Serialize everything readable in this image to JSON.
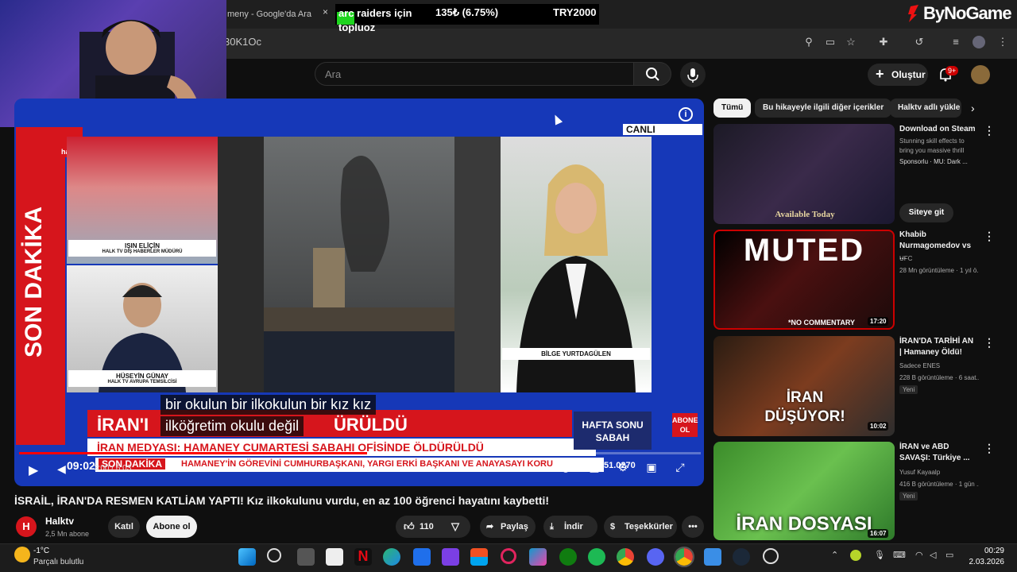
{
  "browser": {
    "tab_title": "meny - Google'da Ara",
    "tab_close": "×",
    "url": "30K1Oc"
  },
  "overlay": {
    "ticker_name": "arc raiders için topluoz",
    "ticker_price": "135₺ (6.75%)",
    "ticker_currency": "TRY2000",
    "brand": "ByNoGame"
  },
  "youtube_header": {
    "search_placeholder": "Ara",
    "create_label": "Oluştur",
    "notification_count": "9+"
  },
  "player": {
    "live_badge": "CANLI",
    "side_banner": "SON DAKİKA",
    "logo_text": "halk",
    "panel_name_1": "IŞIN ELİÇİN",
    "panel_role_1": "HALK TV DIŞ HABERLER MÜDÜRÜ",
    "panel_name_2": "HÜSEYİN GÜNAY",
    "panel_role_2": "HALK TV AVRUPA TEMSİLCİSİ",
    "panel_name_3": "BİLGE YURTDAGÜLEN",
    "headline": "İRAN'I",
    "headline_end": "ÜRÜLDÜ",
    "subline": "İRAN MEDYASI: HAMANEY CUMARTESİ SABAHI OFİSİNDE ÖLDÜRÜLDÜ",
    "program": "HAFTA SONU SABAH",
    "abone": "ABONE OL",
    "ticker_label": "SON DAKİKA",
    "ticker_text": "HAMANEY'İN GÖREVİNİ CUMHURBAŞKANI, YARGI ERKİ BAŞKANI VE ANAYASAYI KORU",
    "ticker_number": "51.0270",
    "caption_line_1": "bir okulun bir ilkokulun bir kız kız",
    "caption_line_2": "ilköğretim okulu değil",
    "tv_clock": "09:02",
    "time_display": "3:00 / 6:03",
    "progress": 0.51
  },
  "video": {
    "title": "İSRAİL, İRAN'DA RESMEN KATLİAM YAPTI! Kız ilkokulunu vurdu, en az 100 öğrenci hayatını kaybetti!",
    "channel_name": "Halktv",
    "channel_avatar": "H",
    "subscribers": "2,5 Mn abone",
    "join_label": "Katıl",
    "subscribe_label": "Abone ol",
    "like_count": "110",
    "share_label": "Paylaş",
    "download_label": "İndir",
    "thanks_label": "Teşekkürler"
  },
  "sidebar": {
    "chips": [
      "Tümü",
      "Bu hikayeyle ilgili diğer içerikler",
      "Halktv adlı yükle"
    ],
    "items": [
      {
        "title": "Download on Steam",
        "line2": "Stunning skill effects to bring you massive thrill",
        "line3": "Sponsorlu · MU: Dark ...",
        "thumb_text": "Available Today",
        "cta": "Siteye git"
      },
      {
        "title": "Khabib Nurmagomedov vs ...",
        "line2": "UFC",
        "line3": "28 Mn görüntüleme · 1 yıl ö...",
        "thumb_text": "MUTED",
        "thumb_sub": "*NO COMMENTARY",
        "duration": "17:20"
      },
      {
        "title": "İRAN'DA TARİHİ AN | Hamaney Öldü!",
        "line2": "Sadece ENES",
        "line3": "228 B görüntüleme · 6 saat...",
        "badge": "Yeni",
        "thumb_text": "İRAN DÜŞÜYOR!",
        "duration": "10:02"
      },
      {
        "title": "İRAN ve ABD SAVAŞI: Türkiye ...",
        "line2": "Yusuf Kayaalp",
        "line3": "416 B görüntüleme · 1 gün ...",
        "badge": "Yeni",
        "thumb_text": "İRAN DOSYASI",
        "duration": "16:07"
      }
    ]
  },
  "taskbar": {
    "temperature": "-1°C",
    "weather": "Parçalı bulutlu",
    "time": "00:29",
    "date": "2.03.2026"
  },
  "colors": {
    "youtube_red": "#ff0000",
    "halk_red": "#d6151c",
    "background": "#0f0f0f",
    "player_blue": "#1638b8"
  }
}
